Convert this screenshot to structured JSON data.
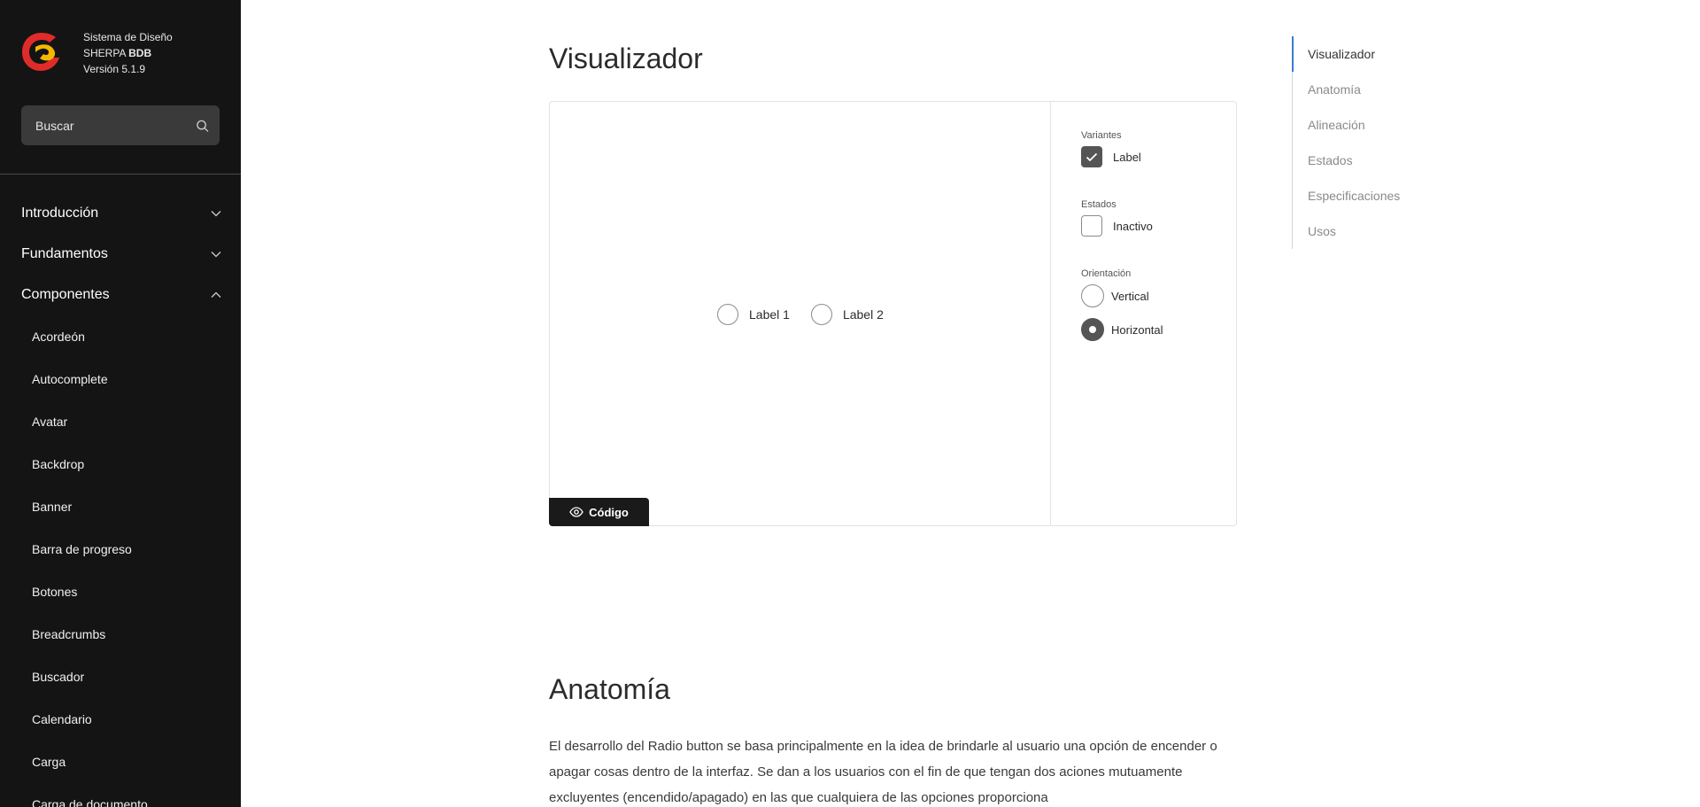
{
  "brand": {
    "line1": "Sistema de Diseño",
    "line2_prefix": "SHERPA ",
    "line2_bold": "BDB",
    "line3": "Versión 5.1.9"
  },
  "search": {
    "placeholder": "Buscar"
  },
  "nav": {
    "groups": [
      {
        "label": "Introducción",
        "expanded": false
      },
      {
        "label": "Fundamentos",
        "expanded": false
      },
      {
        "label": "Componentes",
        "expanded": true
      }
    ],
    "components": [
      "Acordeón",
      "Autocomplete",
      "Avatar",
      "Backdrop",
      "Banner",
      "Barra de progreso",
      "Botones",
      "Breadcrumbs",
      "Buscador",
      "Calendario",
      "Carga",
      "Carga de documento"
    ]
  },
  "main": {
    "viewer_title": "Visualizador",
    "preview": {
      "radios": [
        "Label 1",
        "Label 2"
      ]
    },
    "code_button": "Código",
    "controls": {
      "variants_label": "Variantes",
      "variant_option": "Label",
      "variant_checked": true,
      "states_label": "Estados",
      "state_option": "Inactivo",
      "state_checked": false,
      "orientation_label": "Orientación",
      "orientation_options": [
        "Vertical",
        "Horizontal"
      ],
      "orientation_selected": "Horizontal"
    },
    "section_title": "Anatomía",
    "section_body": "El desarrollo del Radio button se basa principalmente en la idea de brindarle al usuario una opción de encender o apagar cosas dentro de la interfaz. Se dan a los usuarios con el fin de que tengan dos aciones mutuamente excluyentes (encendido/apagado) en las que cualquiera de las opciones proporciona"
  },
  "toc": {
    "items": [
      "Visualizador",
      "Anatomía",
      "Alineación",
      "Estados",
      "Especificaciones",
      "Usos"
    ],
    "active": "Visualizador"
  },
  "colors": {
    "sidebar_bg": "#141414",
    "search_bg": "#3a3a3a",
    "logo_red": "#e02b2b",
    "logo_yellow": "#f5b800",
    "toc_active": "#3a7bd5",
    "control_checked": "#555555"
  }
}
